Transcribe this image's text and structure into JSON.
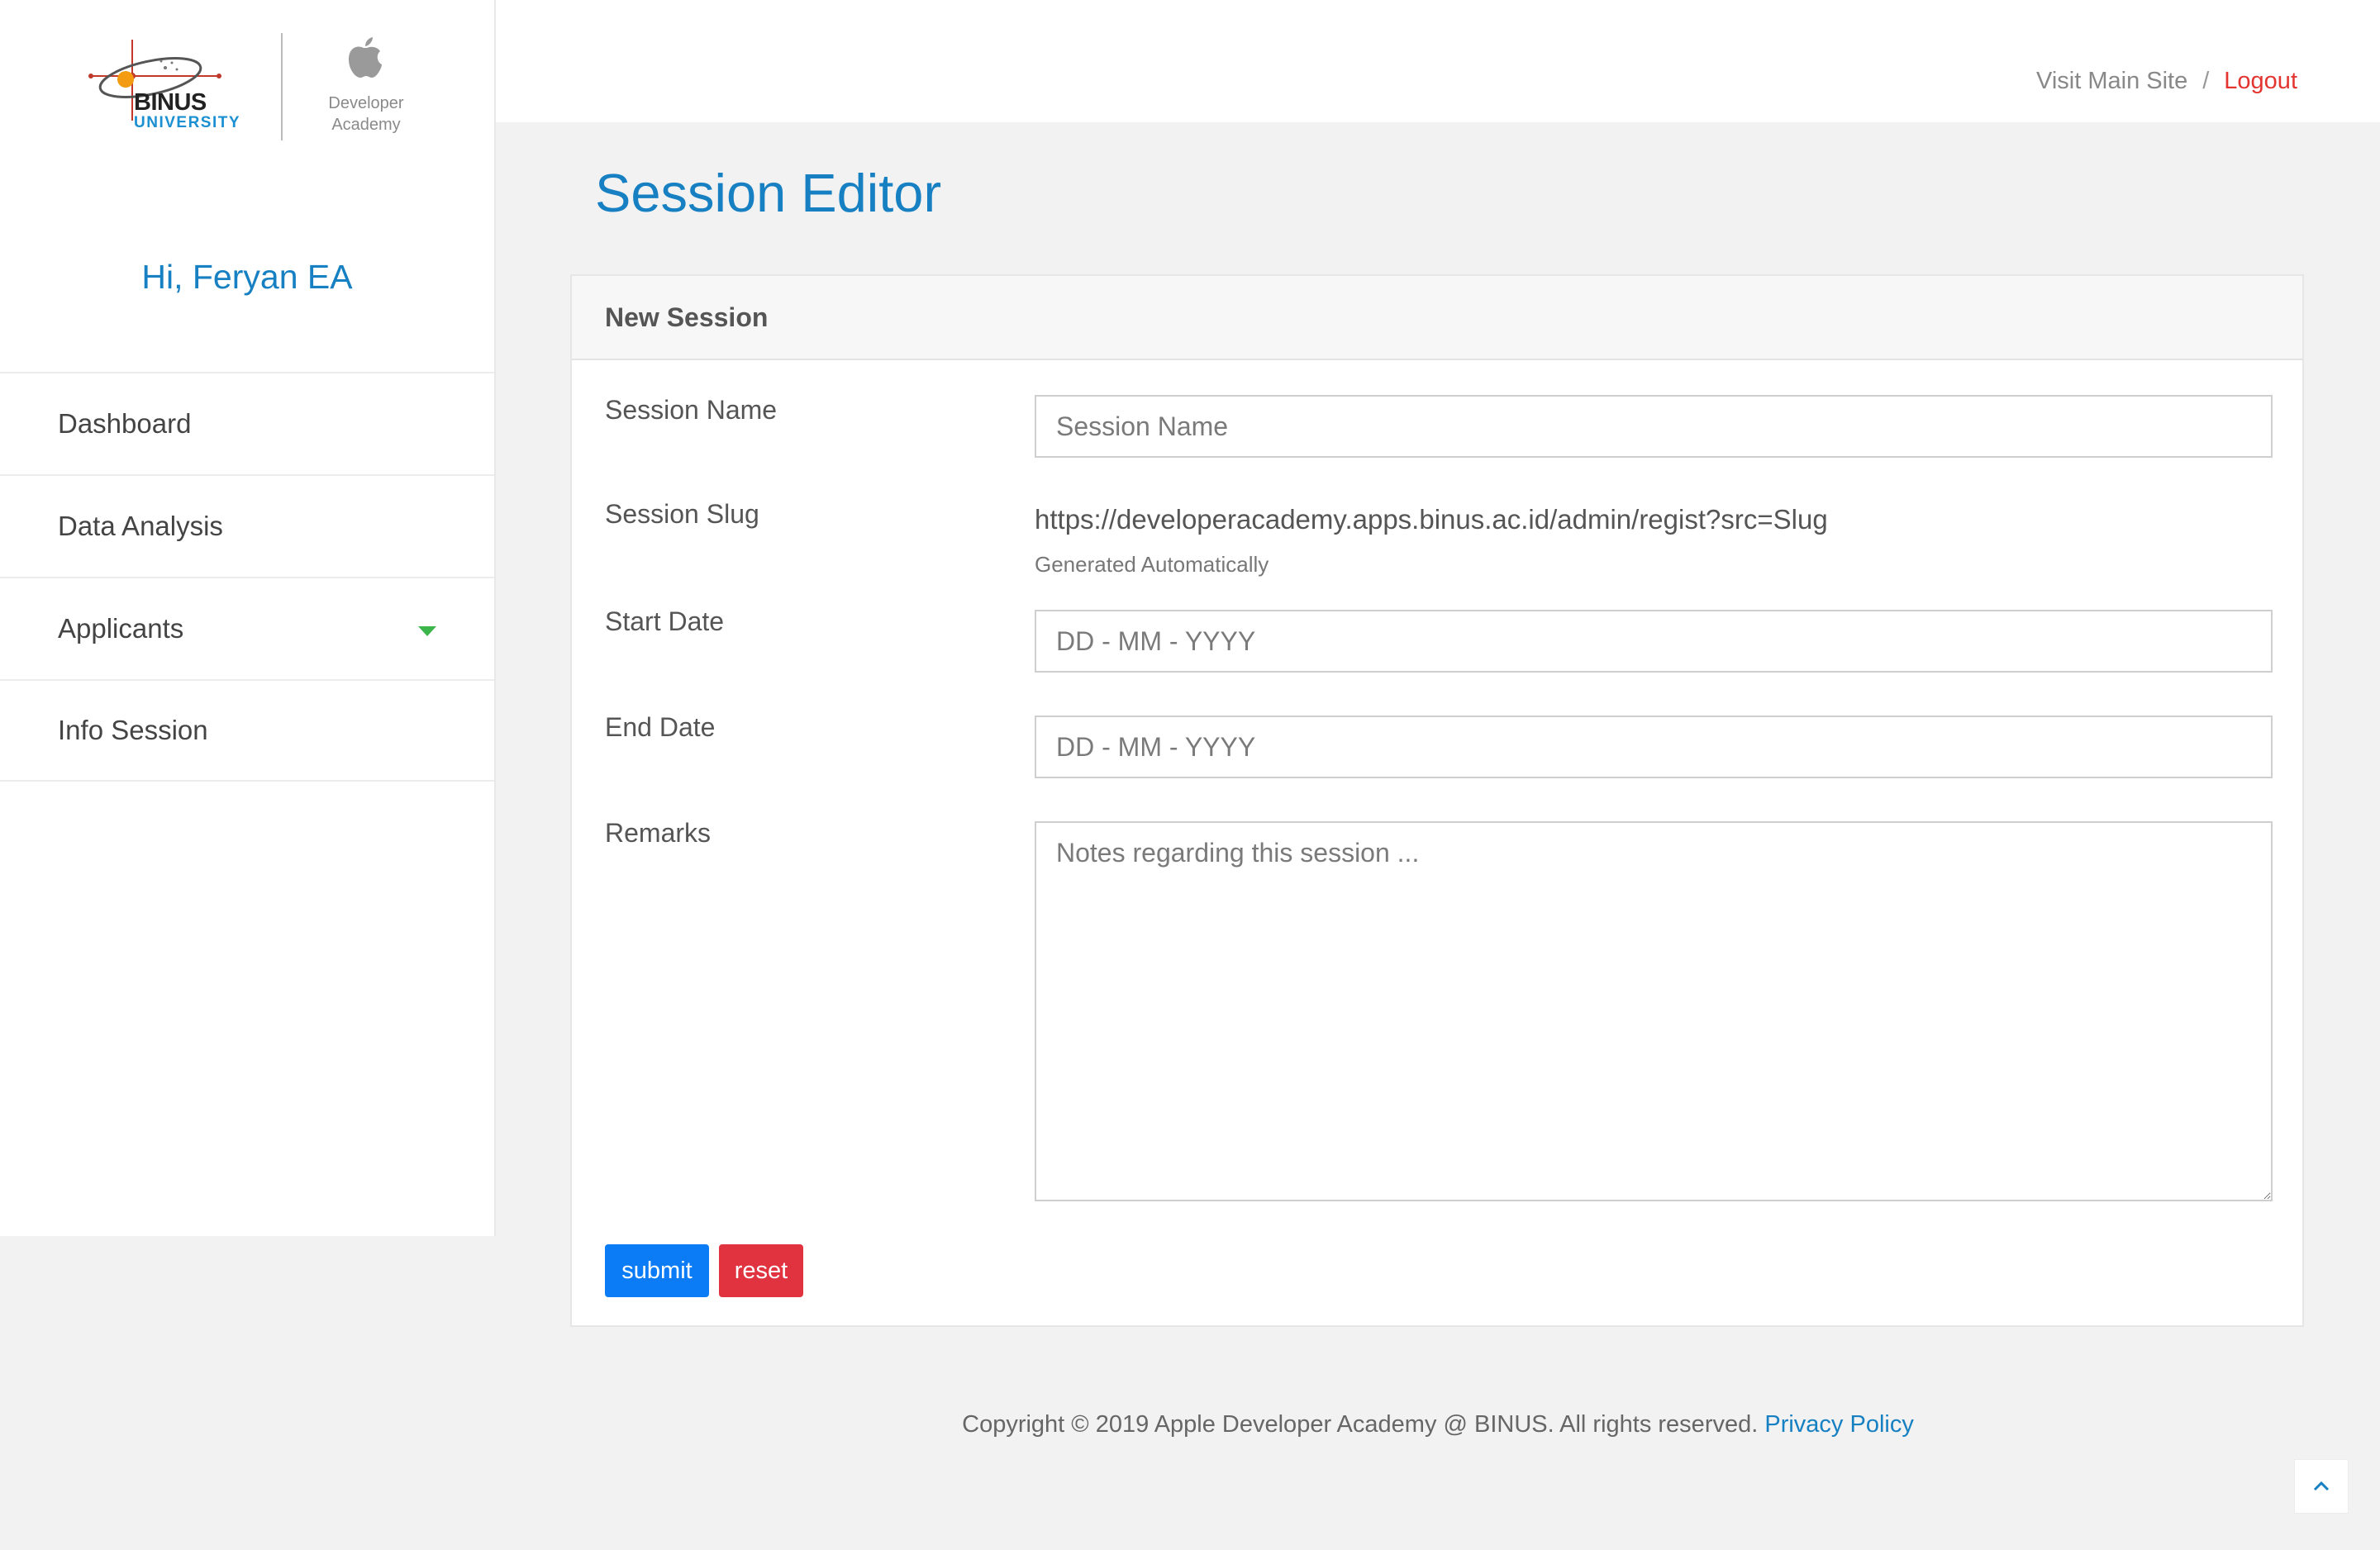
{
  "sidebar": {
    "logo": {
      "brand": "BINUS",
      "sub": "UNIVERSITY",
      "partner_line1": "Developer",
      "partner_line2": "Academy"
    },
    "greeting": "Hi, Feryan EA",
    "items": [
      {
        "label": "Dashboard"
      },
      {
        "label": "Data Analysis"
      },
      {
        "label": "Applicants",
        "icon": "caret-down-icon"
      },
      {
        "label": "Info Session"
      }
    ]
  },
  "topbar": {
    "visit_label": "Visit Main Site",
    "separator": "/",
    "logout_label": "Logout"
  },
  "page": {
    "title": "Session Editor"
  },
  "form": {
    "header": "New Session",
    "session_name": {
      "label": "Session Name",
      "placeholder": "Session Name",
      "value": ""
    },
    "session_slug": {
      "label": "Session Slug",
      "value": "https://developeracademy.apps.binus.ac.id/admin/regist?src=Slug",
      "help": "Generated Automatically"
    },
    "start_date": {
      "label": "Start Date",
      "placeholder": "DD - MM - YYYY",
      "value": ""
    },
    "end_date": {
      "label": "End Date",
      "placeholder": "DD - MM - YYYY",
      "value": ""
    },
    "remarks": {
      "label": "Remarks",
      "placeholder": "Notes regarding this session ...",
      "value": ""
    },
    "submit_label": "submit",
    "reset_label": "reset"
  },
  "footer": {
    "copyright": "Copyright © 2019 Apple Developer Academy @ BINUS. All rights reserved.",
    "privacy_label": "Privacy Policy"
  },
  "colors": {
    "accent": "#1680c2",
    "logout": "#e3342f",
    "submit": "#0b7cf6",
    "reset": "#e0323f",
    "caret": "#3cb54a"
  }
}
